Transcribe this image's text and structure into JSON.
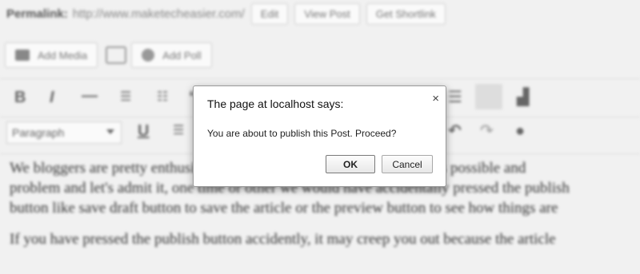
{
  "background_editor": {
    "permalink_label": "Permalink:",
    "permalink_url": "http://www.maketecheasier.com/",
    "buttons": [
      "Edit",
      "View Post",
      "Get Shortlink"
    ],
    "add_media_label": "Add Media",
    "add_poll_label": "Add Poll",
    "format_select_value": "Paragraph",
    "toolbar_row1_icons": [
      "bold-icon",
      "italic-icon",
      "strikethrough-icon",
      "bullet-list-icon",
      "numbered-list-icon",
      "blockquote-icon",
      "align-icon",
      "fullwidth-icon",
      "stats-icon"
    ],
    "toolbar_row2_icons": [
      "underline-icon",
      "justify-icon",
      "undo-icon",
      "redo-icon",
      "help-icon"
    ],
    "body_paragraphs": [
      "We bloggers are pretty enthusiastic about publishing as many articles as possible and",
      "problem and let's admit it, one time or other we would have accidentally pressed the publish",
      "button like save draft button to save the article or the preview button to see how things are",
      "If you have pressed the publish button accidently, it may creep you out because the article"
    ]
  },
  "dialog": {
    "title": "The page at localhost says:",
    "close_glyph": "×",
    "message": "You are about to publish this Post. Proceed?",
    "ok_label": "OK",
    "cancel_label": "Cancel"
  }
}
